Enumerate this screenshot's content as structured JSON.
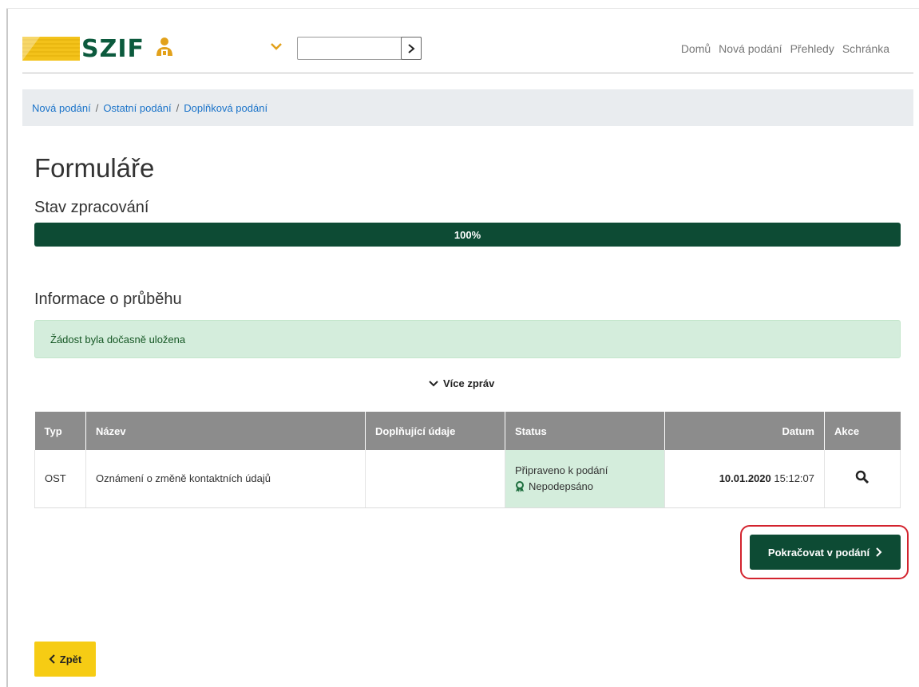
{
  "header": {
    "logo_text": "SZIF",
    "nav": [
      "Domů",
      "Nová podání",
      "Přehledy",
      "Schránka"
    ],
    "search_button_icon": "chevron-right-icon"
  },
  "breadcrumb": [
    "Nová podání",
    "Ostatní podání",
    "Doplňková podání"
  ],
  "page_title": "Formuláře",
  "progress": {
    "label": "Stav zpracování",
    "value_text": "100%",
    "value": 1.0
  },
  "info": {
    "title": "Informace o průběhu",
    "alert_text": "Žádost byla dočasně uložena",
    "more_label": "Více zpráv"
  },
  "table": {
    "headers": [
      "Typ",
      "Název",
      "Doplňující údaje",
      "Status",
      "Datum",
      "Akce"
    ],
    "rows": [
      {
        "typ": "OST",
        "nazev": "Oznámení o změně kontaktních údajů",
        "doplnujici": "",
        "status_1": "Připraveno k podání",
        "status_2": "Nepodepsáno",
        "date": "10.01.2020",
        "time": "15:12:07",
        "action_icon": "search-icon"
      }
    ]
  },
  "buttons": {
    "continue": "Pokračovat v podání",
    "back": "Zpět"
  },
  "colors": {
    "brand_green": "#0d4b34",
    "success_bg": "#d4eddc",
    "back_yellow": "#f6cc14",
    "highlight_red": "#d3232e"
  }
}
